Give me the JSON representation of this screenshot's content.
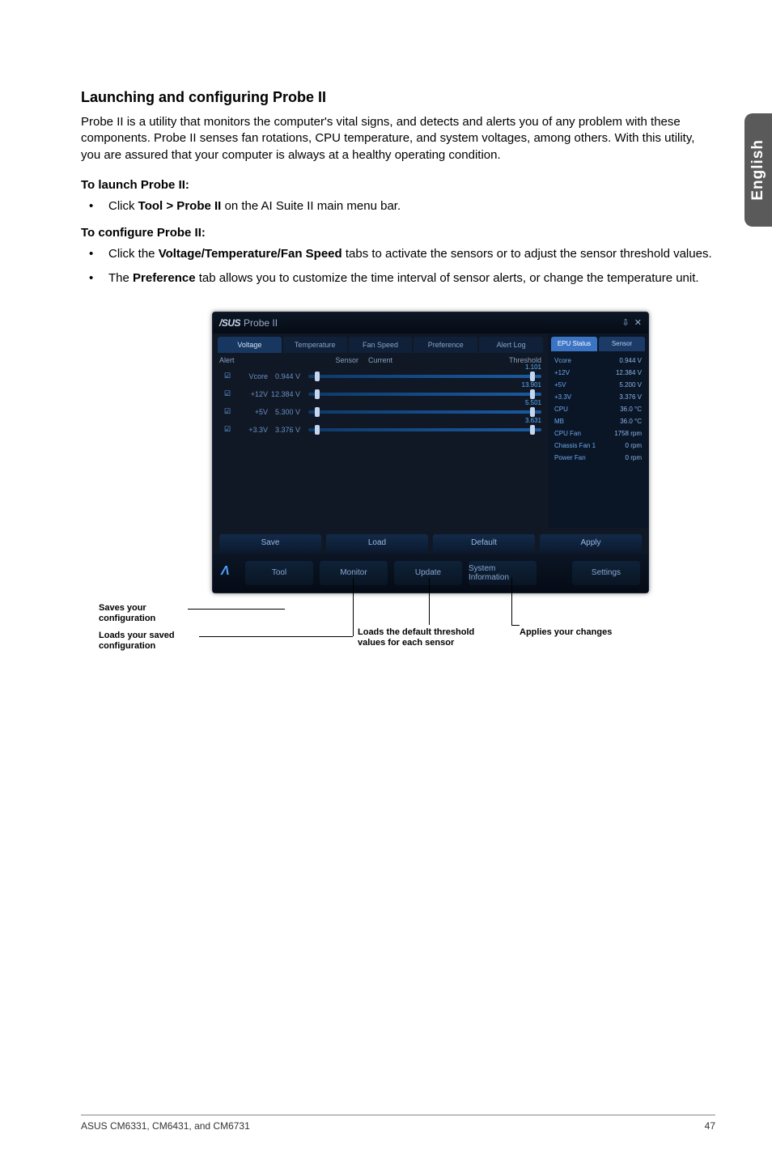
{
  "side_tab": "English",
  "heading": "Launching and configuring Probe II",
  "intro": "Probe II is a utility that monitors the computer's vital signs, and detects and alerts you of any problem with these components. Probe II senses fan rotations, CPU temperature, and system voltages, among others. With this utility, you are assured that your computer is always at a healthy operating condition.",
  "launch_h": "To launch Probe II:",
  "launch_steps": [
    {
      "pre": "Click ",
      "b": "Tool > Probe II",
      "post": " on the AI Suite II main menu bar."
    }
  ],
  "config_h": "To configure Probe II:",
  "config_steps": [
    {
      "pre": "Click the ",
      "b": "Voltage/Temperature/Fan Speed",
      "post": " tabs to activate the sensors or to adjust the sensor threshold values."
    },
    {
      "pre": "The ",
      "b": "Preference",
      "post": " tab allows you to customize the time interval of sensor alerts, or change the temperature unit."
    }
  ],
  "app": {
    "brand": "/SUS",
    "title": "Probe II",
    "min_icon": "⇩",
    "close_icon": "✕",
    "tabs": [
      "Voltage",
      "Temperature",
      "Fan Speed",
      "Preference",
      "Alert Log"
    ],
    "head": {
      "alert": "Alert",
      "sensor": "Sensor",
      "current": "Current",
      "threshold": "Threshold"
    },
    "rows": [
      {
        "sensor": "Vcore",
        "current": "0.944 V",
        "hi": "1.101"
      },
      {
        "sensor": "+12V",
        "current": "12.384 V",
        "hi": "13.901"
      },
      {
        "sensor": "+5V",
        "current": "5.300 V",
        "hi": "5.501"
      },
      {
        "sensor": "+3.3V",
        "current": "3.376 V",
        "hi": "3.631"
      }
    ],
    "status_tabs": [
      "EPU Status",
      "Sensor"
    ],
    "status": [
      {
        "n": "Vcore",
        "v": "0.944 V"
      },
      {
        "n": "+12V",
        "v": "12.384 V"
      },
      {
        "n": "+5V",
        "v": "5.200 V"
      },
      {
        "n": "+3.3V",
        "v": "3.376 V"
      },
      {
        "n": "CPU",
        "v": "36.0 °C"
      },
      {
        "n": "MB",
        "v": "36.0 °C"
      },
      {
        "n": "CPU Fan",
        "v": "1758 rpm"
      },
      {
        "n": "Chassis Fan 1",
        "v": "0 rpm"
      },
      {
        "n": "Power Fan",
        "v": "0 rpm"
      }
    ],
    "btns": {
      "save": "Save",
      "load": "Load",
      "default": "Default",
      "apply": "Apply"
    },
    "bottom": [
      "Tool",
      "Monitor",
      "Update",
      "System Information",
      "Settings"
    ]
  },
  "callouts": {
    "save": "Saves your configuration",
    "load": "Loads your saved configuration",
    "def": "Loads the default threshold values for each sensor",
    "apply": "Applies your changes"
  },
  "footer_left": "ASUS CM6331, CM6431, and CM6731",
  "footer_right": "47"
}
